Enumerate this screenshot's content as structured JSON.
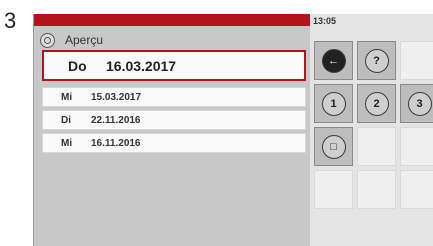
{
  "step_number": "3",
  "header": {
    "title": "Aperçu",
    "time": "13:05"
  },
  "list": {
    "selected": {
      "day": "Do",
      "date": "16.03.2017"
    },
    "items": [
      {
        "day": "Mi",
        "date": "15.03.2017"
      },
      {
        "day": "Di",
        "date": "22.11.2016"
      },
      {
        "day": "Mi",
        "date": "16.11.2016"
      }
    ]
  },
  "right_buttons": {
    "back": "back-arrow",
    "help": "?",
    "b1": "1",
    "b2": "2",
    "b3": "3",
    "b4": "box"
  },
  "colors": {
    "accent_red": "#b3141c"
  }
}
